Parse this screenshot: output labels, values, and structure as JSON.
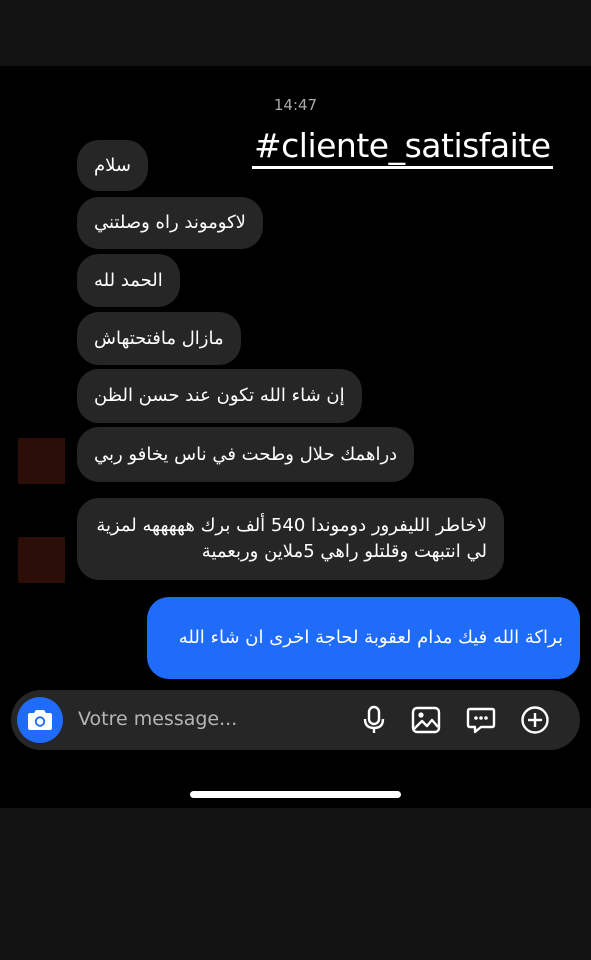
{
  "status": {
    "time": "14:47"
  },
  "overlay": {
    "hashtag": "#cliente_satisfaite"
  },
  "messages": {
    "incoming": [
      "سلام",
      "لاكوموند راه وصلتني",
      "الحمد لله",
      "مازال مافتحتهاش",
      "إن شاء الله تكون عند حسن الظن",
      "دراهمك حلال وطحت في ناس يخافو ربي",
      "لاخاطر الليفرور دوموندا 540 ألف برك هههههه لمزية لي انتبهت وقلتلو راهي 5ملاين وربعمية"
    ],
    "outgoing": [
      "براكة الله فيك مدام لعقوبة لحاجة اخرى ان شاء الله"
    ]
  },
  "composer": {
    "placeholder": "Votre message...",
    "icons": [
      "camera-icon",
      "microphone-icon",
      "gallery-icon",
      "sticker-icon",
      "plus-icon"
    ]
  },
  "colors": {
    "incoming_bubble": "#262626",
    "outgoing_bubble": "#1f6cfa",
    "background": "#000000"
  }
}
